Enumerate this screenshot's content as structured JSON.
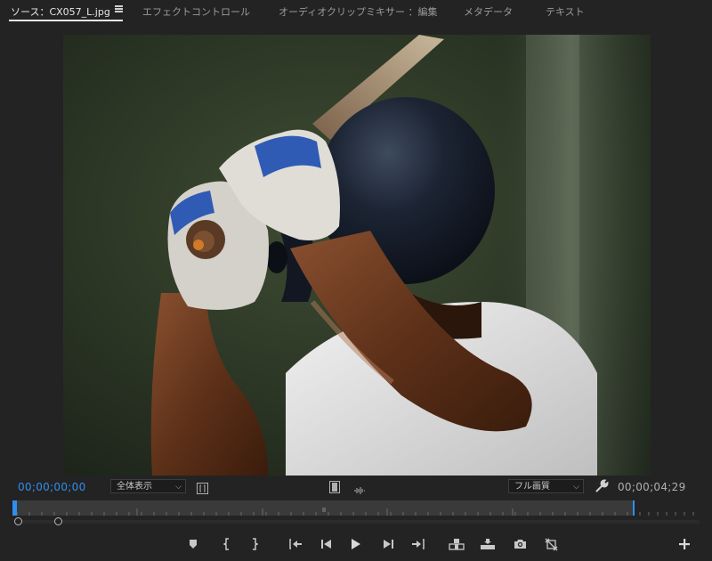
{
  "tabs": [
    {
      "label": "ソース：CX057_L.jpg",
      "active": true
    },
    {
      "label": "エフェクトコントロール",
      "active": false
    },
    {
      "label": "オーディオクリップミキサー ：編集",
      "active": false
    },
    {
      "label": "メタデータ",
      "active": false
    },
    {
      "label": "テキスト",
      "active": false
    }
  ],
  "timecode": {
    "current": "00;00;00;00",
    "duration": "00;00;04;29"
  },
  "zoom_select": {
    "value": "全体表示"
  },
  "quality_select": {
    "value": "フル画質"
  },
  "accent_color": "#2e8ff0",
  "icons": {
    "panel_menu": "hamburger-menu-icon",
    "settings": "wrench-icon",
    "fit": "bracket-frame-icon",
    "safe_margins": "film-strip-icon",
    "drag_audio": "waveform-icon"
  },
  "transport": [
    {
      "name": "add-marker-button",
      "icon": "marker-icon"
    },
    {
      "name": "mark-in-button",
      "icon": "mark-in-icon"
    },
    {
      "name": "mark-out-button",
      "icon": "mark-out-icon"
    },
    {
      "name": "go-to-in-button",
      "icon": "go-to-in-icon"
    },
    {
      "name": "step-back-button",
      "icon": "step-back-icon"
    },
    {
      "name": "play-button",
      "icon": "play-icon"
    },
    {
      "name": "step-forward-button",
      "icon": "step-forward-icon"
    },
    {
      "name": "go-to-out-button",
      "icon": "go-to-out-icon"
    },
    {
      "name": "insert-button",
      "icon": "insert-icon"
    },
    {
      "name": "overwrite-button",
      "icon": "overwrite-icon"
    },
    {
      "name": "export-frame-button",
      "icon": "camera-icon"
    },
    {
      "name": "button-editor-button",
      "icon": "button-editor-icon"
    },
    {
      "name": "add-button",
      "icon": "plus-icon"
    }
  ]
}
